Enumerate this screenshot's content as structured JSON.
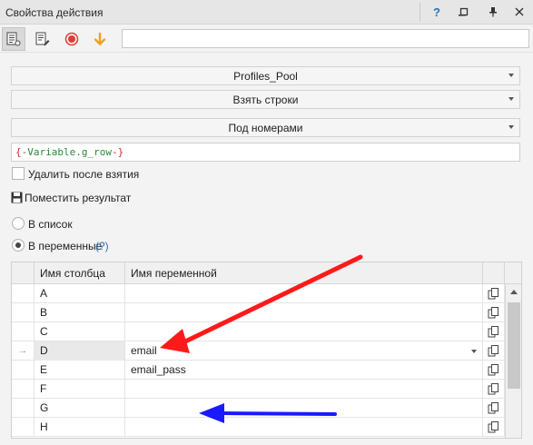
{
  "window": {
    "title": "Свойства действия",
    "help_icon": "question-icon",
    "pin_icon": "pin-icon"
  },
  "toolbar": {
    "input_value": ""
  },
  "dropdowns": {
    "table": "Profiles_Pool",
    "action": "Взять строки",
    "mode": "Под номерами"
  },
  "variable_input": {
    "open": "{-",
    "name": "Variable.g_row",
    "close": "-}"
  },
  "delete_after": {
    "label": "Удалить после взятия",
    "checked": false
  },
  "save_result_label": "Поместить результат",
  "radio": {
    "to_list": "В список",
    "to_variables": "В переменные",
    "help": "(?)"
  },
  "grid": {
    "columns": [
      "Имя столбца",
      "Имя переменной"
    ],
    "rows": [
      {
        "column": "A",
        "variable": ""
      },
      {
        "column": "B",
        "variable": ""
      },
      {
        "column": "C",
        "variable": ""
      },
      {
        "column": "D",
        "variable": "email"
      },
      {
        "column": "E",
        "variable": "email_pass"
      },
      {
        "column": "F",
        "variable": ""
      },
      {
        "column": "G",
        "variable": ""
      },
      {
        "column": "H",
        "variable": ""
      }
    ],
    "current_row_marker": "→"
  },
  "colors": {
    "accent_red": "#ff1a1a",
    "accent_blue": "#1a1aff",
    "record_red": "#e53935",
    "down_arrow_orange": "#f0a020"
  }
}
